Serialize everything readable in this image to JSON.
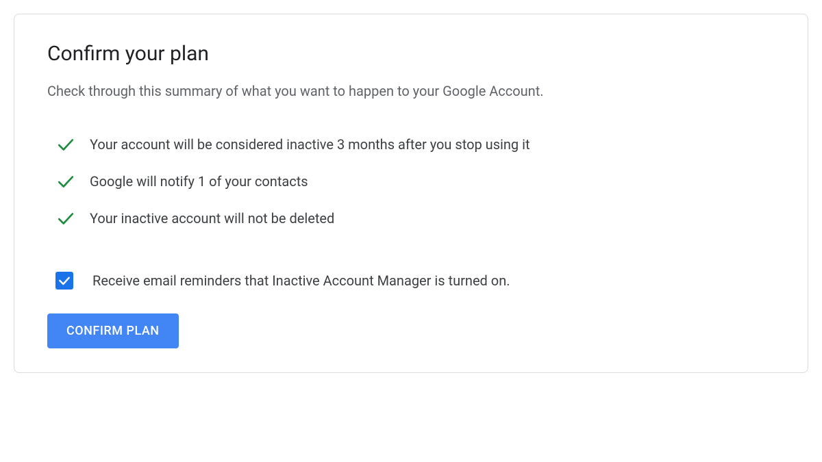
{
  "header": {
    "title": "Confirm your plan",
    "subtitle": "Check through this summary of what you want to happen to your Google Account."
  },
  "summary": {
    "items": [
      {
        "text": "Your account will be considered inactive 3 months after you stop using it"
      },
      {
        "text": "Google will notify 1 of your contacts"
      },
      {
        "text": "Your inactive account will not be deleted"
      }
    ]
  },
  "reminder": {
    "checked": true,
    "label": "Receive email reminders that Inactive Account Manager is turned on."
  },
  "actions": {
    "confirm_label": "CONFIRM PLAN"
  },
  "colors": {
    "check_green": "#1e8e3e",
    "checkbox_blue": "#1a73e8",
    "button_blue": "#4285f4"
  }
}
